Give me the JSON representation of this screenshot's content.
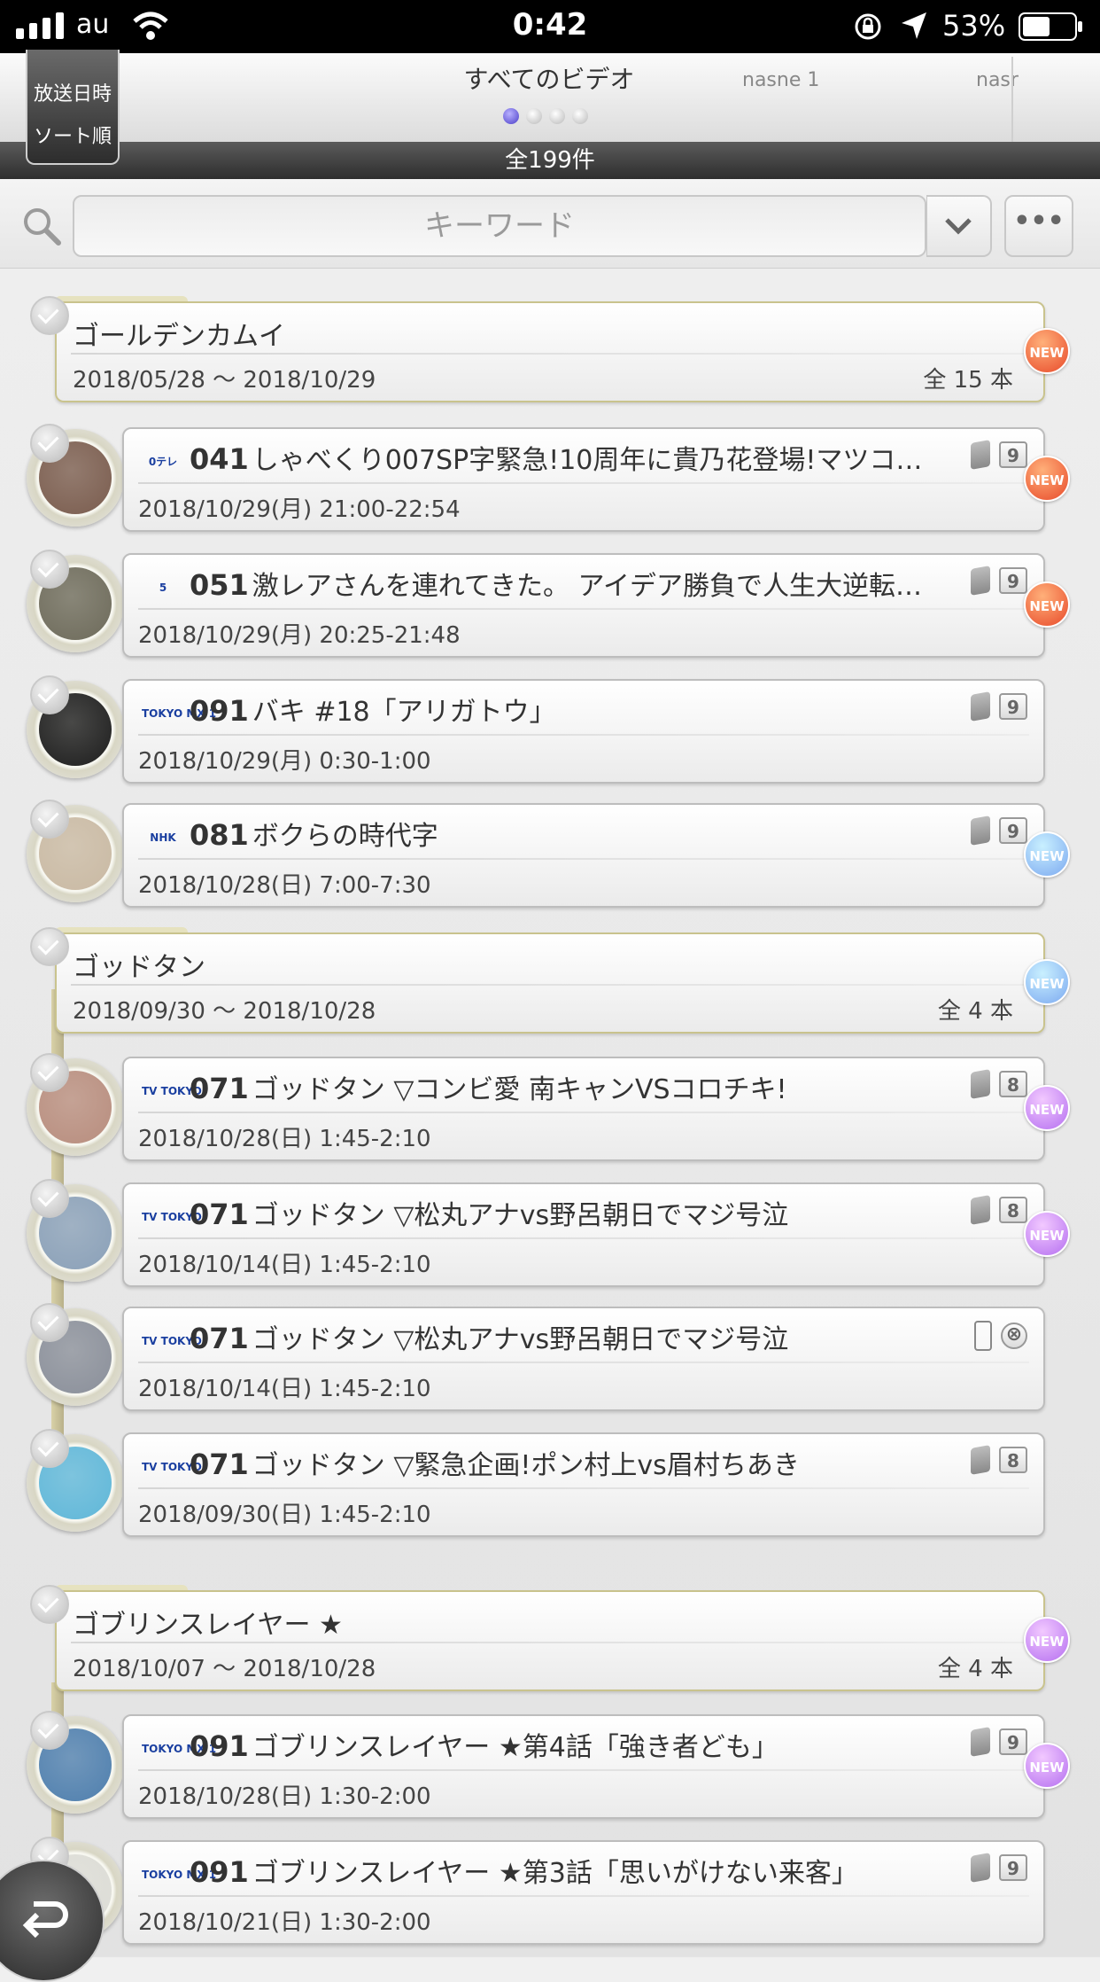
{
  "status_bar": {
    "carrier": "au",
    "time": "0:42",
    "battery": "53%"
  },
  "header": {
    "sort_line1": "放送日時",
    "sort_line2": "ソート順",
    "tab_main": "すべてのビデオ",
    "tab_2": "nasne 1",
    "tab_3": "nasr",
    "count": "全199件"
  },
  "search": {
    "placeholder": "キーワード",
    "more": "•••"
  },
  "colors": {
    "new_red": "#e84a2a",
    "new_blue": "#7ca9f0",
    "new_purple": "#b56ff0",
    "timeline": "#c9c38d"
  },
  "list": [
    {
      "type": "group",
      "title": "ゴールデンカムイ",
      "range": "2018/05/28 〜 2018/10/29",
      "count": "全 15 本",
      "badge": "NEW",
      "badge_color": "red"
    },
    {
      "type": "rec",
      "channel_logo": "0テレ",
      "channel_num": "041",
      "title": "しゃべくり007SP字緊急!10周年に貴乃花登場!マツコ…",
      "date": "2018/10/29(月) 21:00-22:54",
      "device": "1",
      "count": "9",
      "badge": "NEW",
      "badge_color": "red"
    },
    {
      "type": "rec",
      "channel_logo": "5",
      "channel_num": "051",
      "title": "激レアさんを連れてきた。 アイデア勝負で人生大逆転…",
      "date": "2018/10/29(月) 20:25-21:48",
      "device": "2",
      "count": "9",
      "badge": "NEW",
      "badge_color": "red"
    },
    {
      "type": "rec",
      "channel_logo": "TOKYO MX 1",
      "channel_num": "091",
      "title": "バキ #18「アリガトウ」",
      "date": "2018/10/29(月) 0:30-1:00",
      "device": "2",
      "count": "9",
      "badge": "",
      "badge_color": ""
    },
    {
      "type": "rec",
      "channel_logo": "NHK",
      "channel_num": "081",
      "title": "ボクらの時代字",
      "date": "2018/10/28(日) 7:00-7:30",
      "device": "2",
      "count": "9",
      "badge": "NEW",
      "badge_color": "blue"
    },
    {
      "type": "group",
      "title": "ゴッドタン",
      "range": "2018/09/30 〜 2018/10/28",
      "count": "全 4 本",
      "badge": "NEW",
      "badge_color": "blue"
    },
    {
      "type": "rec",
      "channel_logo": "TV TOKYO",
      "channel_num": "071",
      "title": "ゴッドタン ▽コンビ愛 南キャンVSコロチキ!",
      "date": "2018/10/28(日) 1:45-2:10",
      "device": "1",
      "count": "8",
      "badge": "NEW",
      "badge_color": "purple"
    },
    {
      "type": "rec",
      "channel_logo": "TV TOKYO",
      "channel_num": "071",
      "title": "ゴッドタン ▽松丸アナvs野呂朝日でマジ号泣",
      "date": "2018/10/14(日) 1:45-2:10",
      "device": "1",
      "count": "8",
      "badge": "NEW",
      "badge_color": "purple"
    },
    {
      "type": "rec",
      "channel_logo": "TV TOKYO",
      "channel_num": "071",
      "title": "ゴッドタン ▽松丸アナvs野呂朝日でマジ号泣",
      "date": "2018/10/14(日) 1:45-2:10",
      "device": "phone",
      "count": "⊗",
      "badge": "",
      "badge_color": ""
    },
    {
      "type": "rec",
      "channel_logo": "TV TOKYO",
      "channel_num": "071",
      "title": "ゴッドタン ▽緊急企画!ポン村上vs眉村ちあき",
      "date": "2018/09/30(日) 1:45-2:10",
      "device": "1",
      "count": "8",
      "badge": "",
      "badge_color": ""
    },
    {
      "type": "group",
      "title": "ゴブリンスレイヤー ★",
      "range": "2018/10/07 〜 2018/10/28",
      "count": "全 4 本",
      "badge": "NEW",
      "badge_color": "purple"
    },
    {
      "type": "rec",
      "channel_logo": "TOKYO MX 1",
      "channel_num": "091",
      "title": "ゴブリンスレイヤー ★第4話「強き者ども」",
      "date": "2018/10/28(日) 1:30-2:00",
      "device": "2",
      "count": "9",
      "badge": "NEW",
      "badge_color": "purple"
    },
    {
      "type": "rec",
      "channel_logo": "TOKYO MX 1",
      "channel_num": "091",
      "title": "ゴブリンスレイヤー ★第3話「思いがけない来客」",
      "date": "2018/10/21(日) 1:30-2:00",
      "device": "2",
      "count": "9",
      "badge": "",
      "badge_color": ""
    }
  ]
}
